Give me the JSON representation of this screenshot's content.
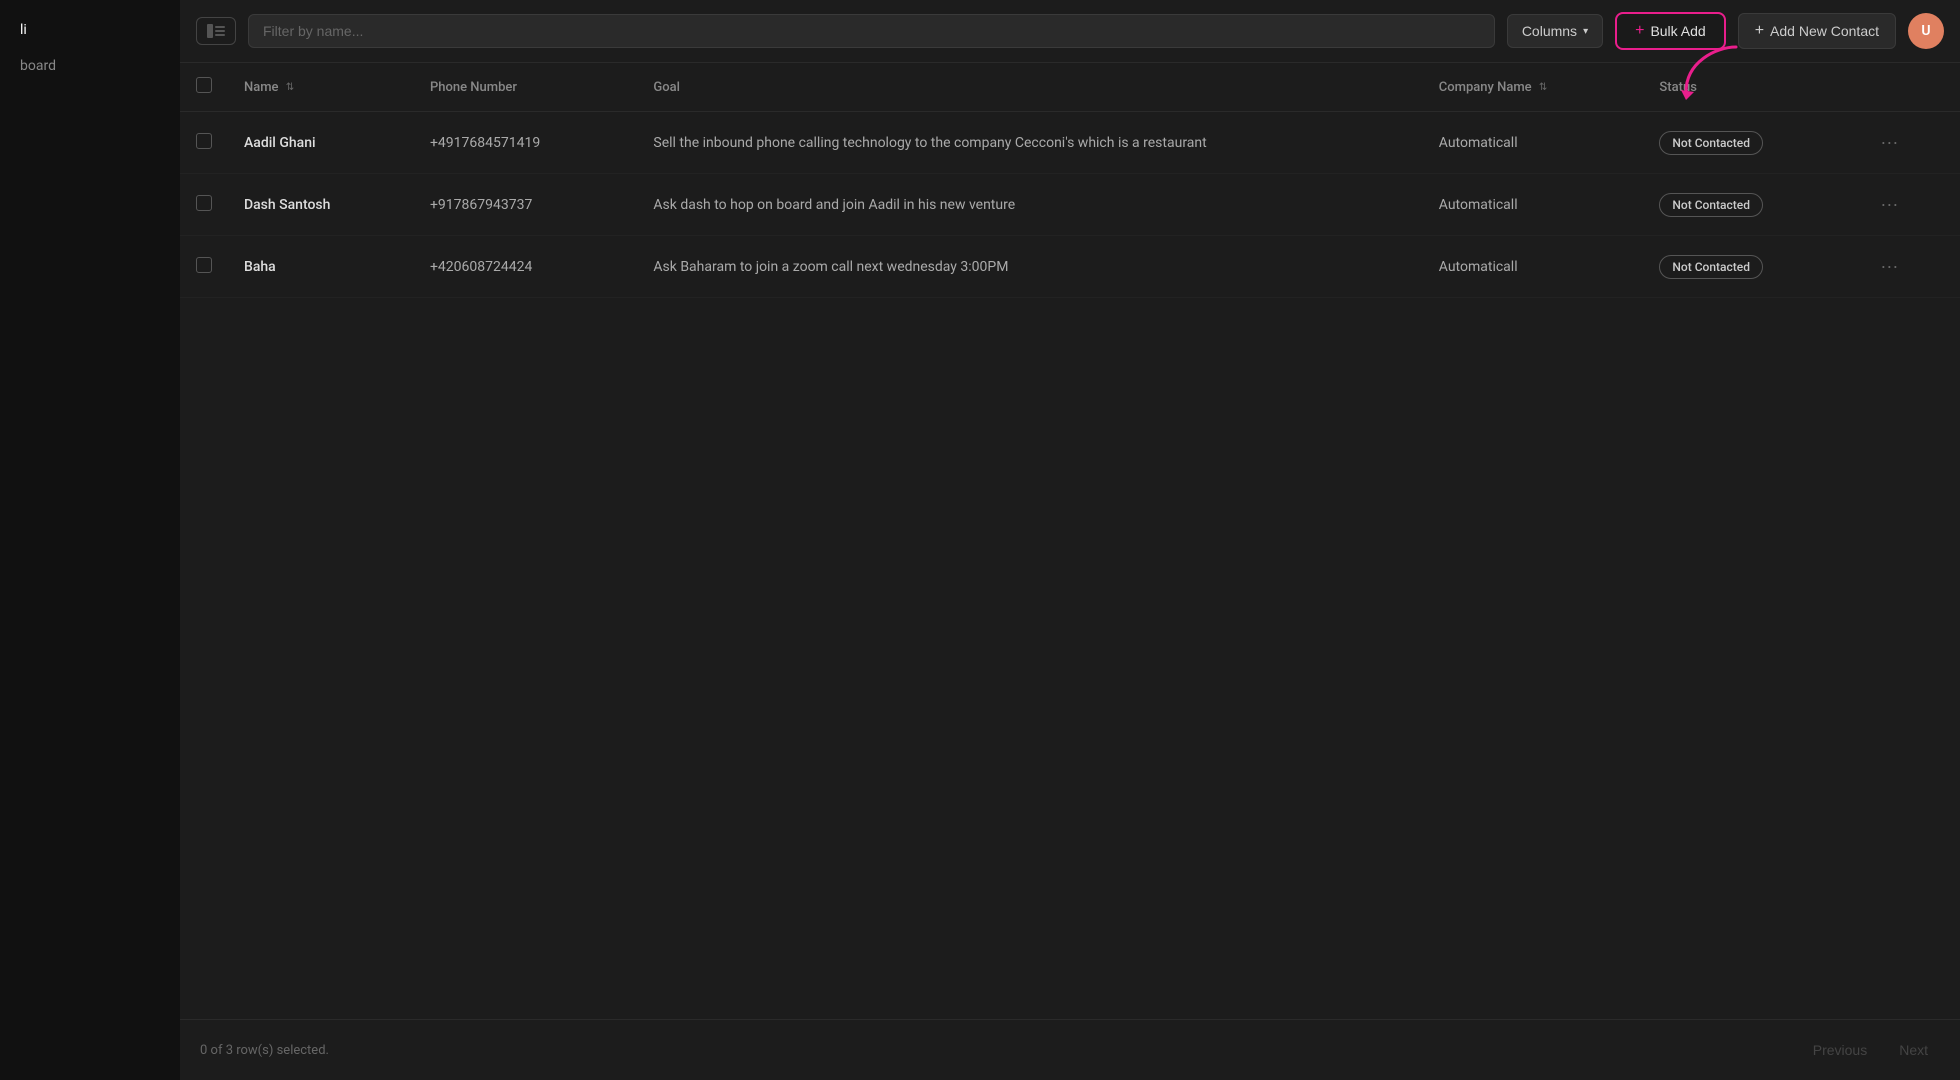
{
  "sidebar": {
    "items": [
      {
        "label": "li",
        "active": true
      },
      {
        "label": "board",
        "active": false
      }
    ]
  },
  "toolbar": {
    "search_placeholder": "Filter by name...",
    "columns_label": "Columns",
    "bulk_add_label": "Bulk Add",
    "add_contact_label": "Add New Contact",
    "avatar_initials": "U"
  },
  "table": {
    "columns": [
      {
        "key": "name",
        "label": "Name",
        "sortable": true
      },
      {
        "key": "phone",
        "label": "Phone Number",
        "sortable": false
      },
      {
        "key": "goal",
        "label": "Goal",
        "sortable": false
      },
      {
        "key": "company",
        "label": "Company Name",
        "sortable": true
      },
      {
        "key": "status",
        "label": "Status",
        "sortable": false
      }
    ],
    "rows": [
      {
        "id": 1,
        "name": "Aadil Ghani",
        "phone": "+4917684571419",
        "goal": "Sell the inbound phone calling technology to the company Cecconi's which is a restaurant",
        "company": "Automaticall",
        "status": "Not Contacted"
      },
      {
        "id": 2,
        "name": "Dash Santosh",
        "phone": "+917867943737",
        "goal": "Ask dash to hop on board and join Aadil in his new venture",
        "company": "Automaticall",
        "status": "Not Contacted"
      },
      {
        "id": 3,
        "name": "Baha",
        "phone": "+420608724424",
        "goal": "Ask Baharam to join a zoom call next wednesday 3:00PM",
        "company": "Automaticall",
        "status": "Not Contacted"
      }
    ]
  },
  "footer": {
    "selection_text": "0 of 3 row(s) selected.",
    "previous_label": "Previous",
    "next_label": "Next"
  }
}
